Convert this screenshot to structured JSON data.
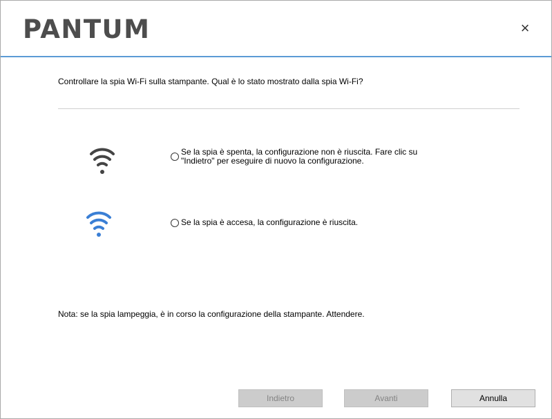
{
  "header": {
    "logo_text": "PANTUM",
    "close_glyph": "×"
  },
  "main": {
    "question": "Controllare la spia Wi-Fi sulla stampante. Qual è lo stato mostrato dalla spia Wi-Fi?",
    "options": [
      {
        "icon": "wifi-off-icon",
        "icon_color": "#444444",
        "line1": "Se la spia è spenta, la configurazione non è riuscita. Fare clic su",
        "line2": "\"Indietro\" per eseguire di nuovo la configurazione."
      },
      {
        "icon": "wifi-on-icon",
        "icon_color": "#3a7fd5",
        "line1": "Se la spia è accesa, la configurazione è riuscita."
      }
    ],
    "note": "Nota:  se la spia lampeggia, è in corso la configurazione della stampante.  Attendere."
  },
  "footer": {
    "back_label": "Indietro",
    "next_label": "Avanti",
    "cancel_label": "Annulla"
  },
  "colors": {
    "accent_line": "#5b9bd5",
    "wifi_off": "#444444",
    "wifi_on": "#3a7fd5",
    "disabled_button": "#cccccc"
  }
}
